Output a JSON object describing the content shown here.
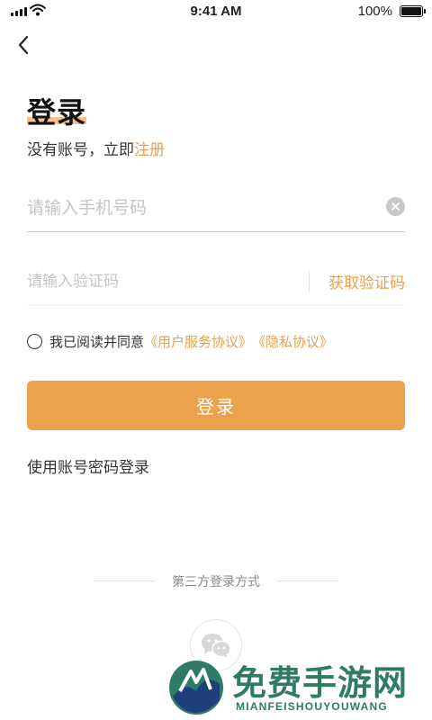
{
  "status_bar": {
    "time": "9:41 AM",
    "battery": "100%",
    "icons": [
      "signal-icon",
      "wifi-icon",
      "battery-icon"
    ]
  },
  "nav": {
    "back_icon": "chevron-left-icon"
  },
  "header": {
    "title": "登录",
    "subtitle_prefix": "没有账号，立即",
    "register_link": "注册"
  },
  "form": {
    "phone_placeholder": "请输入手机号码",
    "phone_value": "",
    "clear_icon": "clear-circle-icon",
    "code_placeholder": "请输入验证码",
    "code_value": "",
    "get_code_label": "获取验证码"
  },
  "agreement": {
    "checked": false,
    "text": "我已阅读并同意",
    "user_agreement": "《用户服务协议》",
    "privacy_policy": "《隐私协议》"
  },
  "actions": {
    "login_label": "登录",
    "password_login_label": "使用账号密码登录"
  },
  "third_party": {
    "label": "第三方登录方式",
    "providers": [
      "wechat-icon"
    ]
  },
  "watermark": {
    "title": "免费手游网",
    "subtitle": "MIANFEISHOUYOUWANG"
  },
  "colors": {
    "accent": "#eba24d",
    "link": "#e9a049",
    "title_underline": "#f1c187",
    "watermark_green": "#2f7b66"
  }
}
